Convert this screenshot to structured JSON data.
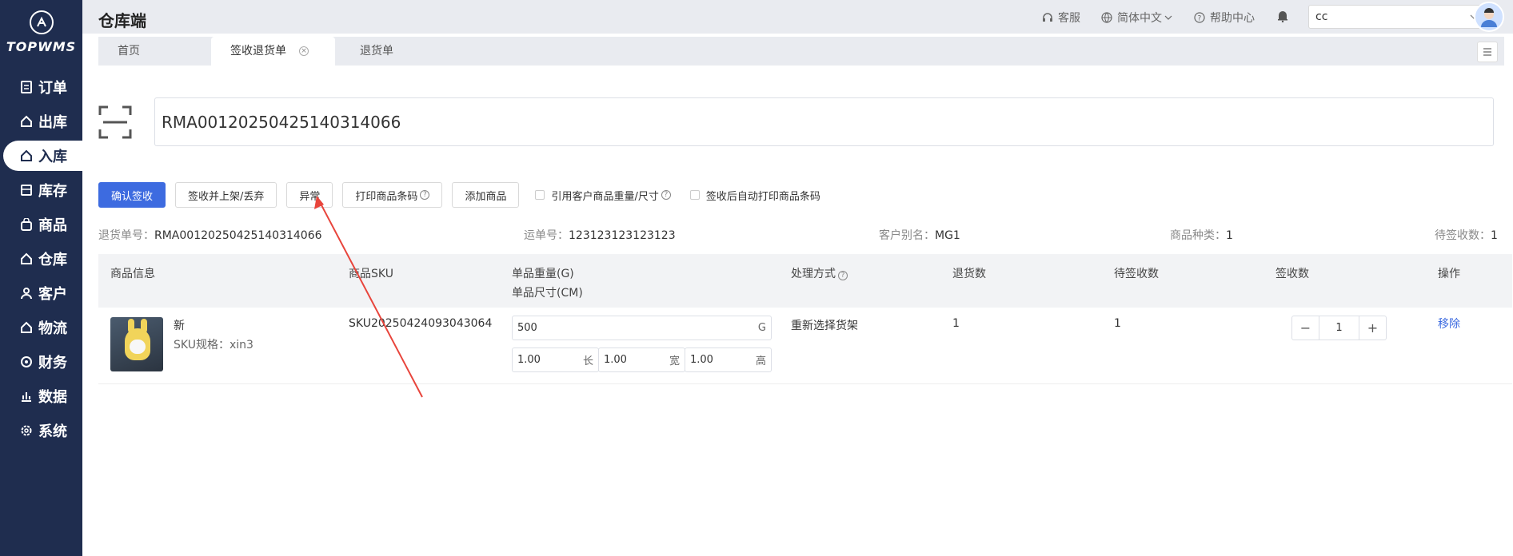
{
  "app": {
    "brand": "TOPWMS",
    "title": "仓库端"
  },
  "sidebar": {
    "items": [
      {
        "label": "订单",
        "icon": "document-icon"
      },
      {
        "label": "出库",
        "icon": "house-out-icon"
      },
      {
        "label": "入库",
        "icon": "house-in-icon",
        "active": true
      },
      {
        "label": "库存",
        "icon": "inventory-icon"
      },
      {
        "label": "商品",
        "icon": "bag-icon"
      },
      {
        "label": "仓库",
        "icon": "warehouse-icon"
      },
      {
        "label": "客户",
        "icon": "user-icon"
      },
      {
        "label": "物流",
        "icon": "truck-icon"
      },
      {
        "label": "财务",
        "icon": "finance-icon"
      },
      {
        "label": "数据",
        "icon": "chart-icon"
      },
      {
        "label": "系统",
        "icon": "gear-icon"
      }
    ]
  },
  "header": {
    "support": "客服",
    "language": "简体中文",
    "help": "帮助中心",
    "warehouse_select": "cc"
  },
  "tabs": [
    {
      "label": "首页"
    },
    {
      "label": "签收退货单",
      "active": true
    },
    {
      "label": "退货单"
    }
  ],
  "scan": {
    "value": "RMA00120250425140314066"
  },
  "toolbar": {
    "confirm": "确认签收",
    "sign_shelve": "签收并上架/丢弃",
    "exception": "异常",
    "print_barcode": "打印商品条码",
    "add_product": "添加商品",
    "check_use_weight": "引用客户商品重量/尺寸",
    "check_auto_print": "签收后自动打印商品条码"
  },
  "info": {
    "return_no_label": "退货单号：",
    "return_no": "RMA00120250425140314066",
    "waybill_label": "运单号：",
    "waybill": "123123123123123",
    "alias_label": "客户别名：",
    "alias": "MG1",
    "kinds_label": "商品种类：",
    "kinds": "1",
    "pending_label": "待签收数：",
    "pending": "1"
  },
  "table": {
    "headers": {
      "product": "商品信息",
      "sku": "商品SKU",
      "weight": "单品重量(G)",
      "size": "单品尺寸(CM)",
      "handle": "处理方式",
      "return_qty": "退货数",
      "pending_qty": "待签收数",
      "sign_qty": "签收数",
      "ops": "操作"
    },
    "rows": [
      {
        "name": "新",
        "spec": "SKU规格：xin3",
        "sku": "SKU20250424093043064",
        "weight": "500",
        "weight_unit": "G",
        "length": "1.00",
        "length_unit": "长",
        "width": "1.00",
        "width_unit": "宽",
        "height": "1.00",
        "height_unit": "高",
        "handle": "重新选择货架",
        "return_qty": "1",
        "pending_qty": "1",
        "sign_qty": "1",
        "remove": "移除"
      }
    ]
  },
  "colors": {
    "sidebar": "#1f2d4f",
    "primary": "#3d6be0",
    "annotation": "#e8453c"
  }
}
